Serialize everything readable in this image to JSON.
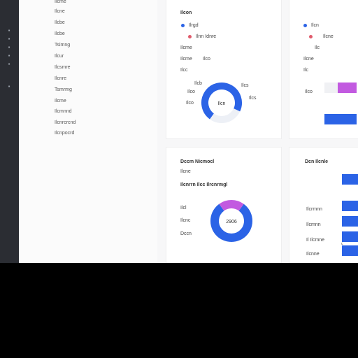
{
  "sidebar": {
    "items": [
      "Ilcme",
      "Ilcne",
      "Ilcbe",
      "Ilcbe",
      "Tsimng",
      "Ilcur",
      "Ilcsmre",
      "Ilcnre",
      "Tsmrmg",
      "Ilcme",
      "Ilcmnnd",
      "Ilcnrcrcnd",
      "Ilcnpocrd"
    ]
  },
  "panel_a": {
    "title": "Ilcon",
    "legend": [
      {
        "label": "Ilrgd",
        "color": "#2b63e6"
      },
      {
        "label": "Ilnn Idnre",
        "color": "#e05a6b"
      }
    ],
    "rows": [
      {
        "label": "Ilcme",
        "value": ""
      },
      {
        "label": "Ilcme",
        "value": "Ilco"
      },
      {
        "label": "Ilcc",
        "value": ""
      }
    ],
    "donut_labels": {
      "top": "Ilcb",
      "left1": "Ilco",
      "left2": "Ilco",
      "right1": "Ilcs",
      "right2": "Ilcs",
      "center": "Ilcn"
    }
  },
  "panel_b": {
    "legend": [
      {
        "label": "Ilcn",
        "color": "#2b63e6"
      },
      {
        "label": "Ilcne",
        "color": "#e05a6b"
      }
    ],
    "rows": [
      "Ilc",
      "Ilcne",
      "Ilc"
    ],
    "bar_label": "Ilco"
  },
  "panel_c": {
    "title": "Dccm Nicmocl",
    "subtitle": "Ilcne",
    "heading": "Ilcnrrn Ilcc Ilrcnrmgl",
    "rows": [
      "Ilcl",
      "Ilcnc",
      "Dccn"
    ],
    "center_value": "2906"
  },
  "panel_d": {
    "title": "Dcn Ilcnle",
    "rows": [
      "Ilcrmnn",
      "Ilcmnn",
      "Il Ilcmne",
      "Ilcnne"
    ],
    "foot": "c"
  },
  "colors": {
    "blue": "#2b63e6",
    "purple": "#c25ae0",
    "red": "#e05a6b",
    "track": "#edf0f6"
  },
  "chart_data": [
    {
      "type": "pie",
      "categories": [
        "blue",
        "light"
      ],
      "values": [
        72,
        28
      ],
      "title": "",
      "center_label": "Ilcn"
    },
    {
      "type": "pie",
      "categories": [
        "blue",
        "purple"
      ],
      "values": [
        80,
        20
      ],
      "title": "",
      "center_label": "2906"
    },
    {
      "type": "bar",
      "orientation": "horizontal",
      "categories": [
        "Ilcrmnn",
        "Ilcmnn",
        "Il Ilcmne",
        "Ilcnne"
      ],
      "values": [
        100,
        100,
        100,
        100
      ],
      "xlim": [
        0,
        100
      ],
      "title": "Dcn Ilcnle",
      "xlabel": "",
      "ylabel": ""
    }
  ]
}
